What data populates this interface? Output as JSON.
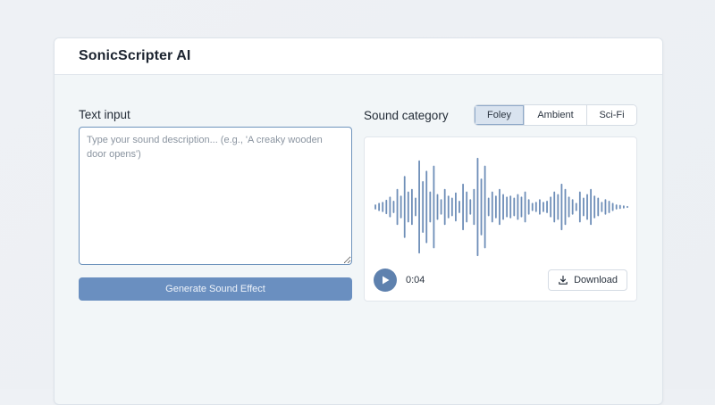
{
  "app": {
    "title": "SonicScripter AI"
  },
  "text_input": {
    "label": "Text input",
    "value": "",
    "placeholder": "Type your sound description... (e.g., 'A creaky wooden door opens')",
    "generate_button": "Generate Sound Effect"
  },
  "category": {
    "label": "Sound category",
    "options": [
      "Foley",
      "Ambient",
      "Sci-Fi"
    ],
    "selected": "Foley"
  },
  "player": {
    "time": "0:04",
    "download_label": "Download",
    "waveform_color": "#6e8eb8",
    "waveform_levels": [
      0.05,
      0.08,
      0.1,
      0.14,
      0.2,
      0.12,
      0.35,
      0.22,
      0.6,
      0.3,
      0.35,
      0.18,
      0.9,
      0.5,
      0.7,
      0.3,
      0.8,
      0.25,
      0.15,
      0.35,
      0.22,
      0.18,
      0.28,
      0.12,
      0.45,
      0.3,
      0.15,
      0.35,
      0.95,
      0.55,
      0.8,
      0.18,
      0.3,
      0.22,
      0.35,
      0.25,
      0.2,
      0.22,
      0.18,
      0.25,
      0.2,
      0.3,
      0.15,
      0.08,
      0.1,
      0.15,
      0.1,
      0.12,
      0.2,
      0.3,
      0.25,
      0.45,
      0.35,
      0.2,
      0.15,
      0.08,
      0.3,
      0.18,
      0.25,
      0.35,
      0.22,
      0.18,
      0.1,
      0.15,
      0.12,
      0.08,
      0.05,
      0.04,
      0.03,
      0.02
    ]
  },
  "colors": {
    "accent": "#6a8fc0",
    "play_button": "#5e81ae"
  }
}
